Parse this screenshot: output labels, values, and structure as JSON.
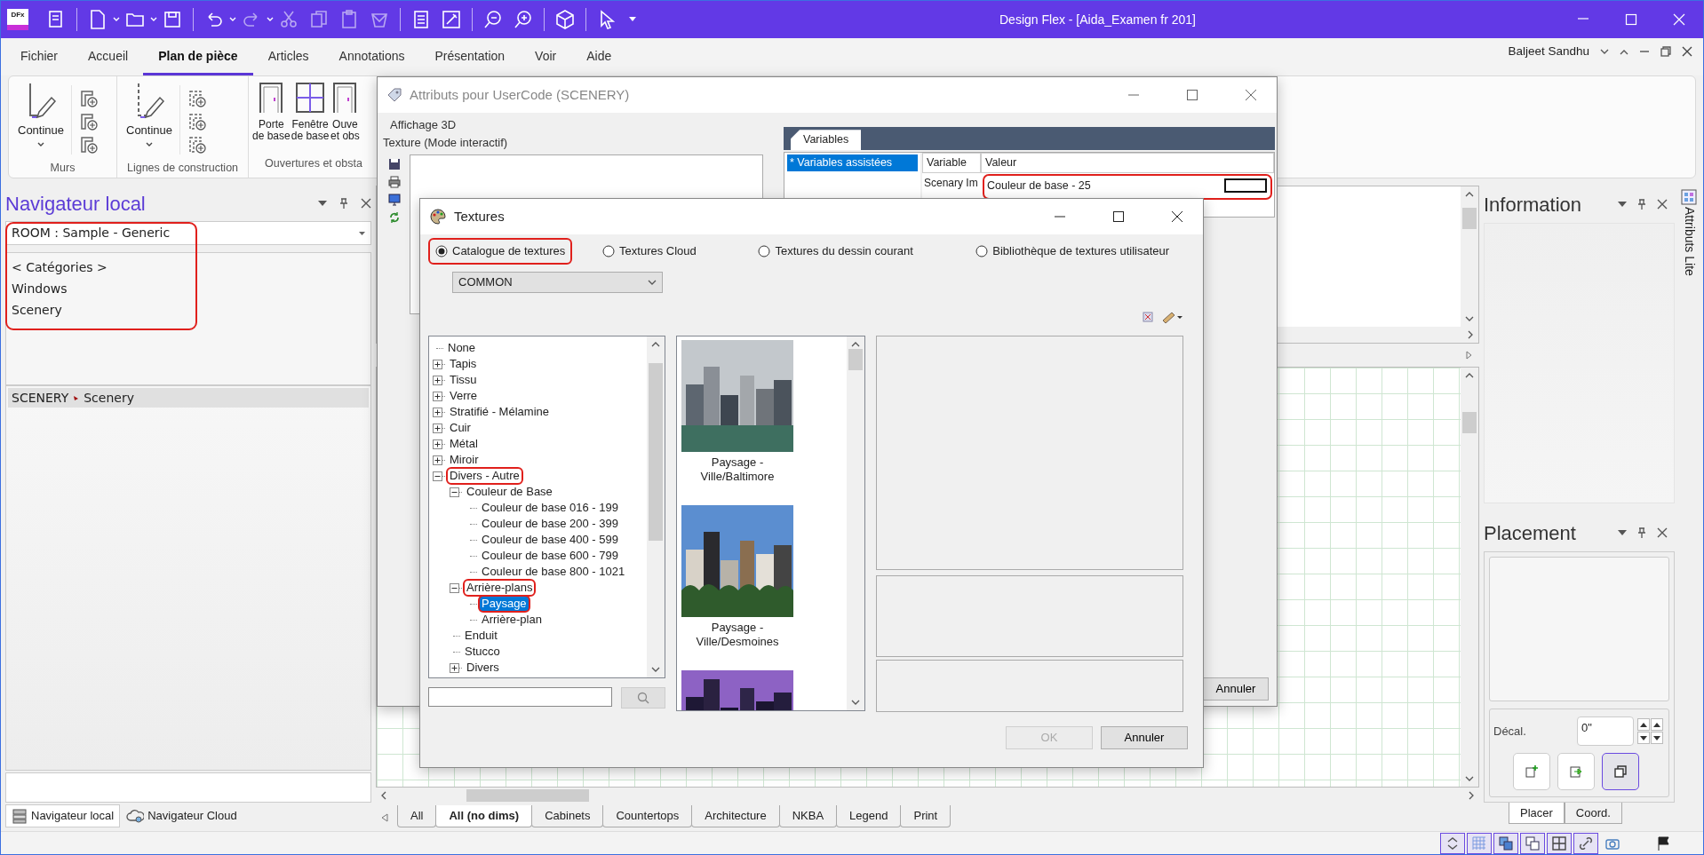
{
  "window": {
    "logo": "DFx",
    "title": "Design Flex - [Aida_Examen fr 201]"
  },
  "ribbon_tabs": [
    {
      "label": "Fichier",
      "selected": false
    },
    {
      "label": "Accueil",
      "selected": false
    },
    {
      "label": "Plan de pièce",
      "selected": true
    },
    {
      "label": "Articles",
      "selected": false
    },
    {
      "label": "Annotations",
      "selected": false
    },
    {
      "label": "Présentation",
      "selected": false
    },
    {
      "label": "Voir",
      "selected": false
    },
    {
      "label": "Aide",
      "selected": false
    }
  ],
  "user": {
    "name": "Baljeet Sandhu"
  },
  "ribbon_groups": [
    {
      "label": "Murs",
      "kind": "split",
      "button": "Continue"
    },
    {
      "label": "Lignes de construction",
      "kind": "split",
      "button": "Continue"
    },
    {
      "label": "Ouvertures et obsta",
      "kind": "openings",
      "buttons": [
        {
          "lines": [
            "Porte",
            "de base"
          ]
        },
        {
          "lines": [
            "Fenêtre",
            "de base"
          ]
        },
        {
          "lines": [
            "Ouve",
            "et obs"
          ]
        }
      ]
    }
  ],
  "navigator": {
    "title": "Navigateur local",
    "filter": "ROOM : Sample - Generic",
    "annotated": true,
    "categories": [
      "< Catégories >",
      "Windows",
      "Scenery"
    ],
    "items": [
      {
        "code": "SCENERY",
        "name": "Scenery",
        "selected": true
      }
    ],
    "tabs": [
      {
        "label": "Navigateur local",
        "selected": true
      },
      {
        "label": "Navigateur Cloud",
        "selected": false
      }
    ]
  },
  "sheet_tabs": [
    {
      "label": "All",
      "selected": false
    },
    {
      "label": "All (no dims)",
      "selected": true
    },
    {
      "label": "Cabinets",
      "selected": false
    },
    {
      "label": "Countertops",
      "selected": false
    },
    {
      "label": "Architecture",
      "selected": false
    },
    {
      "label": "NKBA",
      "selected": false
    },
    {
      "label": "Legend",
      "selected": false
    },
    {
      "label": "Print",
      "selected": false
    }
  ],
  "information": {
    "title": "Information"
  },
  "side_tab": {
    "label": "Attributs Lite"
  },
  "placement": {
    "title": "Placement",
    "offset_label": "Décal.",
    "offset_value": "0\"",
    "action_buttons": [
      {
        "pressed": false
      },
      {
        "pressed": false
      },
      {
        "pressed": true
      }
    ],
    "tabs": [
      {
        "label": "Placer",
        "selected": true
      },
      {
        "label": "Coord.",
        "selected": false
      }
    ]
  },
  "status_toggles": [
    {
      "on": true
    },
    {
      "on": true
    },
    {
      "on": true
    },
    {
      "on": true
    },
    {
      "on": true
    },
    {
      "on": true
    },
    {
      "on": false
    },
    {
      "on": false
    }
  ],
  "attributes_dialog": {
    "title": "Attributs pour UserCode (SCENERY)",
    "group": "Affichage 3D",
    "field_label": "Texture (Mode interactif)",
    "tab": "Variables",
    "categories": [
      {
        "label": "* Variables assistées",
        "selected": true
      }
    ],
    "columns": [
      "Variable",
      "Valeur"
    ],
    "rows": [
      {
        "variable": "Scenary Im",
        "value": "Couleur de base - 25",
        "color": "#ffffff",
        "annotated": true
      }
    ],
    "cancel": "Annuler"
  },
  "textures_dialog": {
    "title": "Textures",
    "sources": [
      {
        "label": "Catalogue de textures",
        "selected": true,
        "annotated": true
      },
      {
        "label": "Textures Cloud",
        "selected": false
      },
      {
        "label": "Textures du dessin courant",
        "selected": false
      },
      {
        "label": "Bibliothèque de textures utilisateur",
        "selected": false
      }
    ],
    "library": "COMMON",
    "tree": [
      {
        "label": "None",
        "selected": false
      },
      {
        "label": "Tapis",
        "expanded": false,
        "selected": false
      },
      {
        "label": "Tissu",
        "expanded": false,
        "selected": false
      },
      {
        "label": "Verre",
        "expanded": false,
        "selected": false
      },
      {
        "label": "Stratifié - Mélamine",
        "expanded": false,
        "selected": false
      },
      {
        "label": "Cuir",
        "expanded": false,
        "selected": false
      },
      {
        "label": "Métal",
        "expanded": false,
        "selected": false
      },
      {
        "label": "Miroir",
        "expanded": false,
        "selected": false
      },
      {
        "label": "Divers - Autre",
        "expanded": true,
        "selected": false,
        "annotated": true,
        "children": [
          {
            "label": "Couleur de Base",
            "expanded": true,
            "selected": false,
            "children": [
              {
                "label": "Couleur de base 016 - 199",
                "selected": false
              },
              {
                "label": "Couleur de base 200 - 399",
                "selected": false
              },
              {
                "label": "Couleur de base 400 - 599",
                "selected": false
              },
              {
                "label": "Couleur de base 600 - 799",
                "selected": false
              },
              {
                "label": "Couleur de base 800 - 1021",
                "selected": false
              }
            ]
          },
          {
            "label": "Arrière-plans",
            "expanded": true,
            "selected": false,
            "annotated": true,
            "children": [
              {
                "label": "Paysage",
                "selected": true,
                "annotated": true
              },
              {
                "label": "Arrière-plan",
                "selected": false
              }
            ]
          },
          {
            "label": "Enduit",
            "selected": false
          },
          {
            "label": "Stucco",
            "selected": false
          },
          {
            "label": "Divers",
            "expanded": false,
            "selected": false
          }
        ]
      }
    ],
    "thumbnails": [
      {
        "kind": "picture",
        "caption_lines": [
          "Paysage -",
          "Ville/Baltimore"
        ]
      },
      {
        "kind": "picture",
        "caption_lines": [
          "Paysage -",
          "Ville/Desmoines"
        ]
      },
      {
        "kind": "picture"
      }
    ],
    "buttons": [
      {
        "label": "OK",
        "disabled": true
      },
      {
        "label": "Annuler",
        "disabled": false
      }
    ]
  }
}
